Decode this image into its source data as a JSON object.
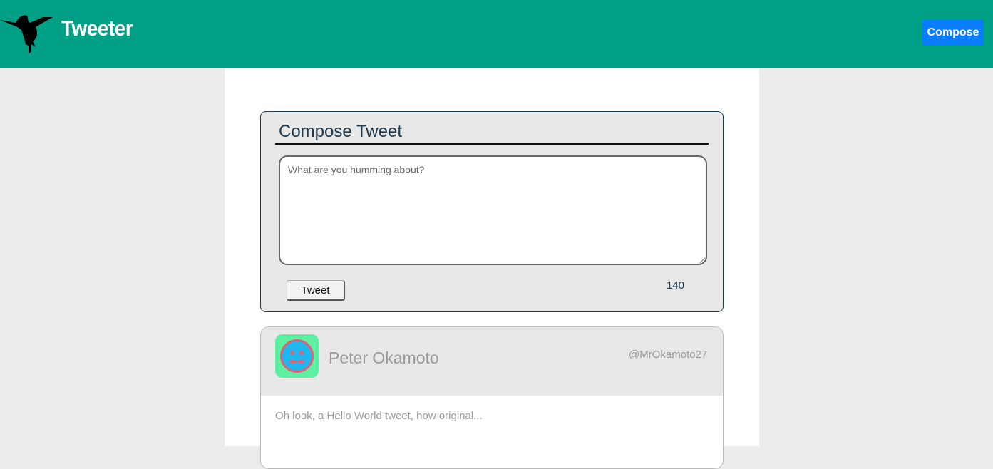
{
  "nav": {
    "brand": "Tweeter",
    "compose_label": "Compose",
    "logo_icon": "hummingbird-icon",
    "color": "#00a087",
    "button_color": "#0a7cff"
  },
  "compose": {
    "title": "Compose Tweet",
    "placeholder": "What are you humming about?",
    "tweet_label": "Tweet",
    "counter": "140"
  },
  "tweets": [
    {
      "name": "Peter Okamoto",
      "handle": "@MrOkamoto27",
      "text": "Oh look, a Hello World tweet, how original...",
      "avatar_icon": "face-avatar-icon"
    }
  ]
}
